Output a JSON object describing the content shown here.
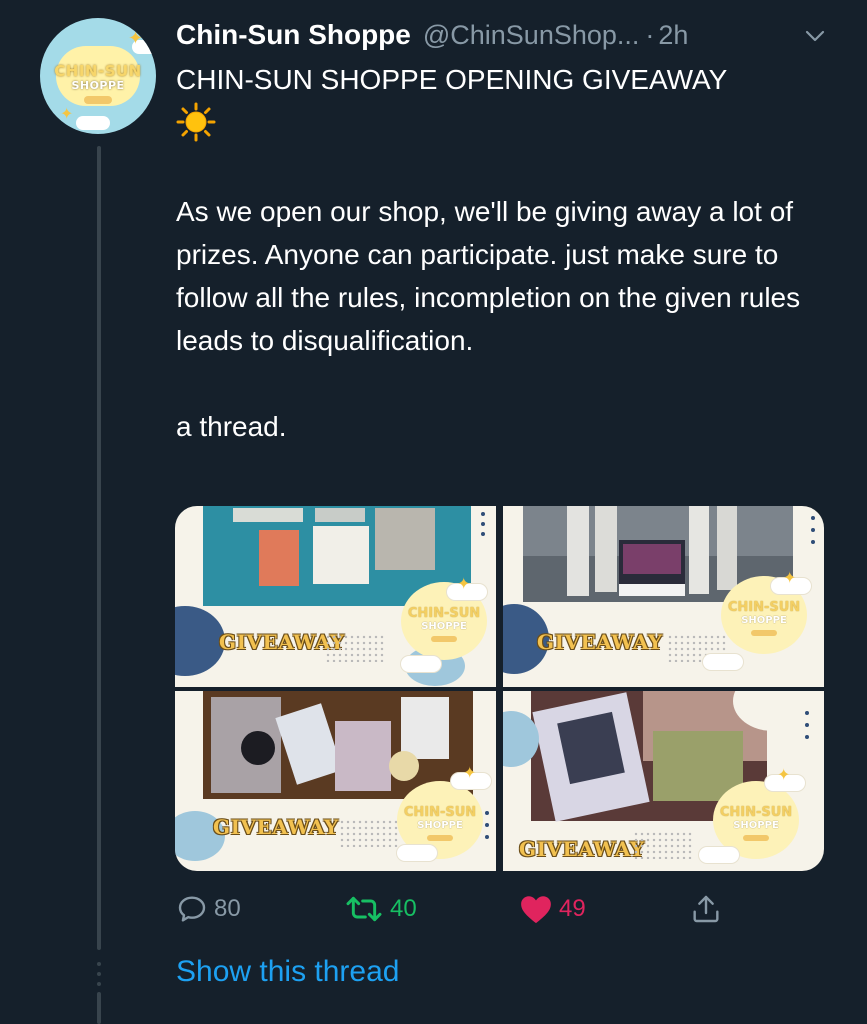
{
  "tweet": {
    "avatar": {
      "brand_line1": "CHIN-SUN",
      "brand_line2": "SHOPPE"
    },
    "display_name": "Chin-Sun Shoppe",
    "handle": "@ChinSunShop...",
    "separator": "·",
    "time": "2h",
    "title": "CHIN-SUN SHOPPE OPENING GIVEAWAY",
    "emoji": "sun-emoji",
    "paragraphs": [
      "As we open our shop, we'll be giving away a lot of prizes. Anyone can participate. just make sure to follow all the rules, incompletion on the given rules leads to disqualification.",
      "a thread."
    ],
    "media": [
      {
        "label": "GIVEAWAY",
        "badge_line1": "CHIN-SUN",
        "badge_line2": "SHOPPE"
      },
      {
        "label": "GIVEAWAY",
        "badge_line1": "CHIN-SUN",
        "badge_line2": "SHOPPE"
      },
      {
        "label": "GIVEAWAY",
        "badge_line1": "CHIN-SUN",
        "badge_line2": "SHOPPE"
      },
      {
        "label": "GIVEAWAY",
        "badge_line1": "CHIN-SUN",
        "badge_line2": "SHOPPE"
      }
    ],
    "actions": {
      "reply_count": "80",
      "retweet_count": "40",
      "like_count": "49"
    },
    "show_thread": "Show this thread"
  },
  "colors": {
    "background": "#15202b",
    "secondary_text": "#8899a6",
    "link": "#1da1f2",
    "retweet": "#17bf63",
    "like": "#e0245e"
  }
}
